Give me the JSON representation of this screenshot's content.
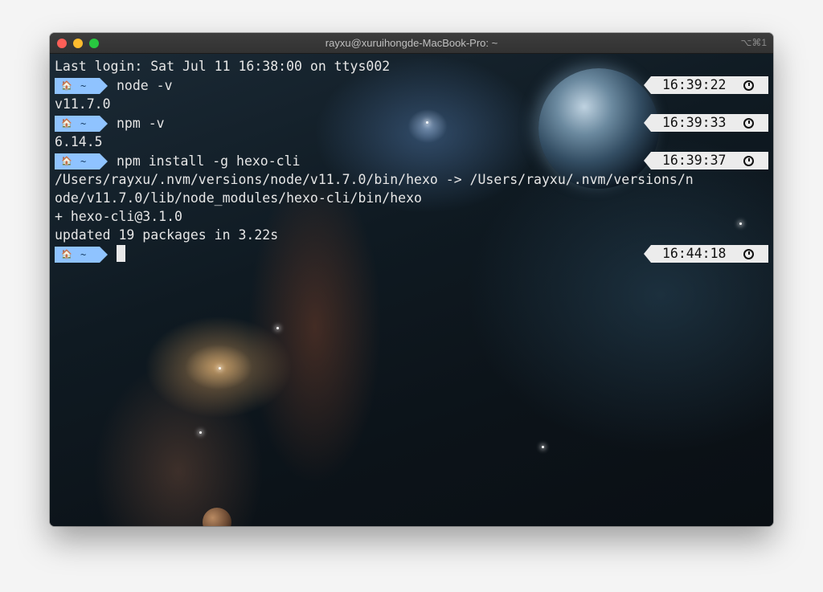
{
  "window": {
    "title": "rayxu@xuruihongde-MacBook-Pro: ~",
    "shortcut": "⌥⌘1"
  },
  "prompt": {
    "home_icon": "home-icon",
    "dir": "~",
    "color": "#8fc3ff"
  },
  "terminal": {
    "last_login": "Last login: Sat Jul 11 16:38:00 on ttys002",
    "commands": [
      {
        "command": "node -v",
        "time": "16:39:22"
      },
      {
        "command": "npm -v",
        "time": "16:39:33"
      },
      {
        "command": "npm install -g hexo-cli",
        "time": "16:39:37"
      },
      {
        "command": "",
        "time": "16:44:18"
      }
    ],
    "outputs": {
      "node_version": "v11.7.0",
      "npm_version": "6.14.5",
      "link_line1": "/Users/rayxu/.nvm/versions/node/v11.7.0/bin/hexo -> /Users/rayxu/.nvm/versions/n",
      "link_line2": "ode/v11.7.0/lib/node_modules/hexo-cli/bin/hexo",
      "installed": "+ hexo-cli@3.1.0",
      "summary": "updated 19 packages in 3.22s"
    }
  }
}
